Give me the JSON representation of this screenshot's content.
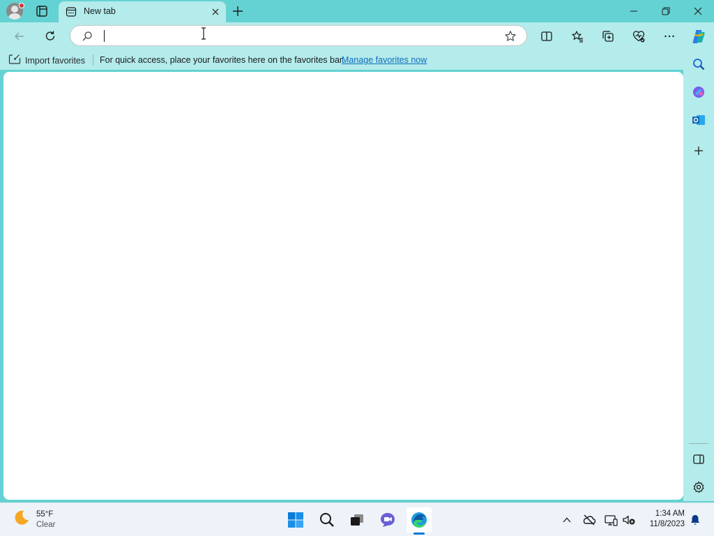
{
  "window": {
    "tab_title": "New tab",
    "has_notification_dot": true
  },
  "toolbar": {
    "address_value": "",
    "address_placeholder": ""
  },
  "favorites_bar": {
    "import_label": "Import favorites",
    "message": "For quick access, place your favorites here on the favorites bar.",
    "manage_link": "Manage favorites now"
  },
  "sidebar": {
    "items": [
      "search-icon",
      "copilot-icon",
      "outlook-icon",
      "add-icon"
    ],
    "bottom_items": [
      "split-screen-icon",
      "gear-icon"
    ]
  },
  "taskbar": {
    "weather_temp": "55°F",
    "weather_condition": "Clear",
    "apps": [
      "start-icon",
      "search-icon",
      "task-view-icon",
      "teams-chat-icon",
      "edge-icon"
    ],
    "clock_time": "1:34 AM",
    "clock_date": "11/8/2023"
  },
  "colors": {
    "chrome": "#b4ebeb",
    "frame": "#64d2d2",
    "link": "#0f6cbd",
    "accent": "#0078d4"
  }
}
